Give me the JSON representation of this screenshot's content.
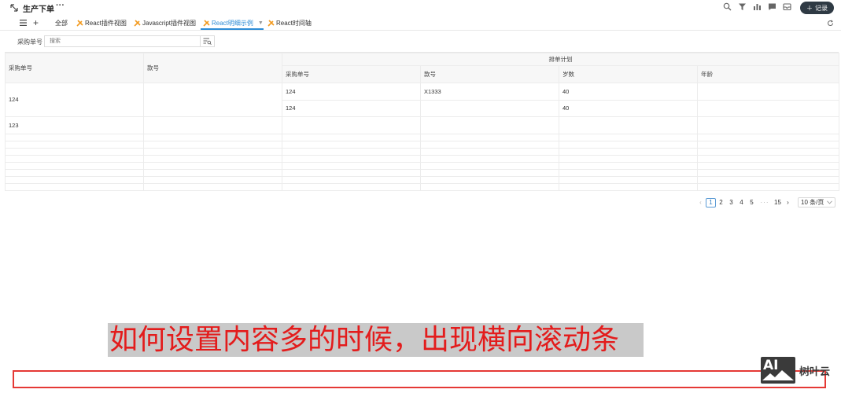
{
  "header": {
    "title": "生产下单",
    "more": "···",
    "record_button": "记录"
  },
  "tabs": [
    {
      "label": "全部"
    },
    {
      "label": "React插件视图"
    },
    {
      "label": "Javascript插件视图"
    },
    {
      "label": "React明细示例",
      "active": true
    },
    {
      "label": "React时间轴"
    }
  ],
  "filter": {
    "label": "采购单号",
    "placeholder": "搜索"
  },
  "table": {
    "columns": {
      "purchase_no": "采购单号",
      "style_no": "款号",
      "group": "排单计划",
      "sub_purchase_no": "采购单号",
      "sub_style_no": "款号",
      "age_years": "岁数",
      "age": "年龄"
    },
    "rows": [
      {
        "purchase_no": "124",
        "sub": [
          {
            "purchase_no": "124",
            "style_no": "X1333",
            "age_years": "40",
            "age": ""
          },
          {
            "purchase_no": "124",
            "style_no": "",
            "age_years": "40",
            "age": ""
          }
        ]
      },
      {
        "purchase_no": "123",
        "sub": []
      }
    ]
  },
  "pagination": {
    "pages": [
      "1",
      "2",
      "3",
      "4",
      "5"
    ],
    "ellipsis": "···",
    "last": "15",
    "page_size": "10 条/页",
    "current": "1"
  },
  "caption": "如何设置内容多的时候，出现横向滚动条",
  "watermark": {
    "logo": "AI",
    "name": "树叶云"
  }
}
